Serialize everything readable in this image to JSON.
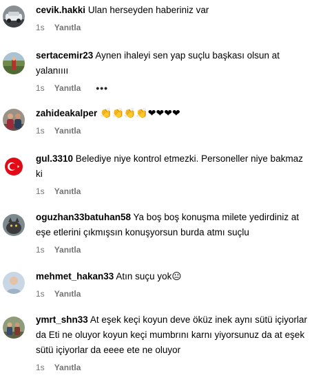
{
  "comments": [
    {
      "username": "cevik.hakki",
      "text": "Ulan herseyden haberiniz var",
      "time": "1s",
      "reply_label": "Yanıtla"
    },
    {
      "username": "sertacemir23",
      "text": "Aynen ihaleyi sen yap suçlu başkası olsun at yalanıııı",
      "time": "1s",
      "reply_label": "Yanıtla",
      "more_label": "•••"
    },
    {
      "username": "zahideakalper",
      "text": "👏👏👏👏❤❤❤❤",
      "time": "1s",
      "reply_label": "Yanıtla"
    },
    {
      "username": "gul.3310",
      "text": "Belediye niye kontrol etmezki. Personeller niye bakmaz ki",
      "time": "1s",
      "reply_label": "Yanıtla"
    },
    {
      "username": "oguzhan33batuhan58",
      "text": "Ya boş boş konuşma milete yedirdiniz at eşe etlerini çıkmışsın konuşyorsun burda atmı suçlu",
      "time": "1s",
      "reply_label": "Yanıtla"
    },
    {
      "username": "mehmet_hakan33",
      "text": "Atın suçu yok😐",
      "time": "1s",
      "reply_label": "Yanıtla"
    },
    {
      "username": "ymrt_shn33",
      "text": "At eşek keçi koyun deve öküz inek aynı sütü içiyorlar da Eti ne oluyor koyun keçi mumbrını karnı yiyorsunuz da at eşek sütü içiyorlar da eeee ete ne oluyor",
      "time": "1s",
      "reply_label": "Yanıtla"
    }
  ],
  "colors": {
    "meta_text": "#737373",
    "body_text": "#000000",
    "background": "#ffffff"
  }
}
